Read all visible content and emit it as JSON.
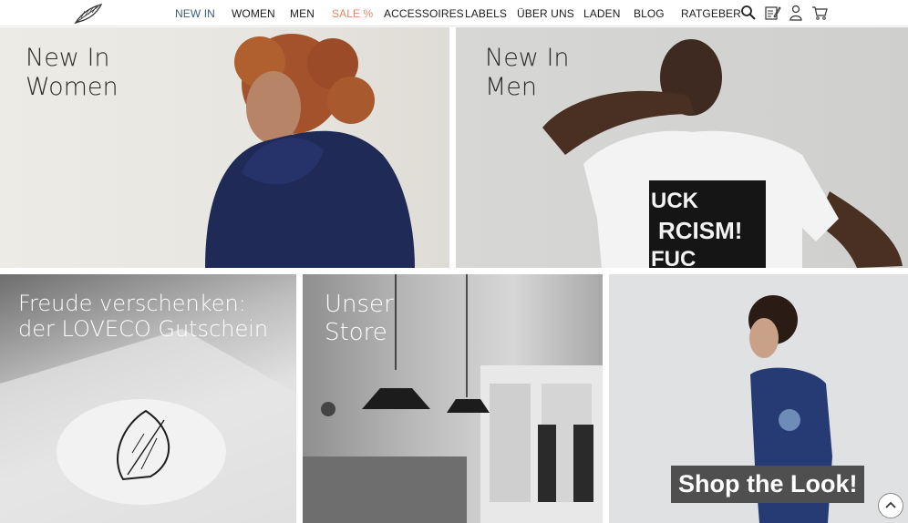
{
  "header": {
    "nav": [
      {
        "label": "NEW IN",
        "state": "active"
      },
      {
        "label": "WOMEN"
      },
      {
        "label": "MEN"
      },
      {
        "label": "SALE %",
        "state": "sale"
      },
      {
        "label": "ACCESSOIRES"
      },
      {
        "label": "LABELS"
      },
      {
        "label": "ÜBER UNS"
      },
      {
        "label": "LADEN"
      },
      {
        "label": "BLOG"
      },
      {
        "label": "RATGEBER"
      }
    ],
    "icons": [
      "search-icon",
      "wishlist-icon",
      "account-icon",
      "cart-icon"
    ]
  },
  "tiles": {
    "women": {
      "title": "New In\nWomen"
    },
    "men": {
      "title": "New In\nMen"
    },
    "gift": {
      "title": "Freude verschenken:\nder LOVECO Gutschein"
    },
    "store": {
      "title": "Unser\nStore"
    },
    "look": {
      "label": "Shop the Look!"
    }
  },
  "colors": {
    "nav_active": "#3d5a7a",
    "nav_sale": "#e08a6a",
    "label_bg": "#4f4f4f"
  }
}
